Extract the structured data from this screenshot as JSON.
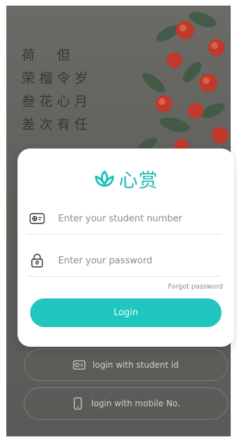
{
  "background": {
    "poem_lines": [
      "荷　但",
      "荣榴令岁",
      "叁花心月",
      "差次有任"
    ]
  },
  "brand": {
    "name": "心赏",
    "accent_color": "#1fc1bb"
  },
  "form": {
    "student_number_placeholder": "Enter your student number",
    "password_placeholder": "Enter your password",
    "forgot_password": "Forgot password",
    "login_label": "Login"
  },
  "alt_login": {
    "student_id_label": "login with student id",
    "mobile_label": "login with mobile No."
  }
}
